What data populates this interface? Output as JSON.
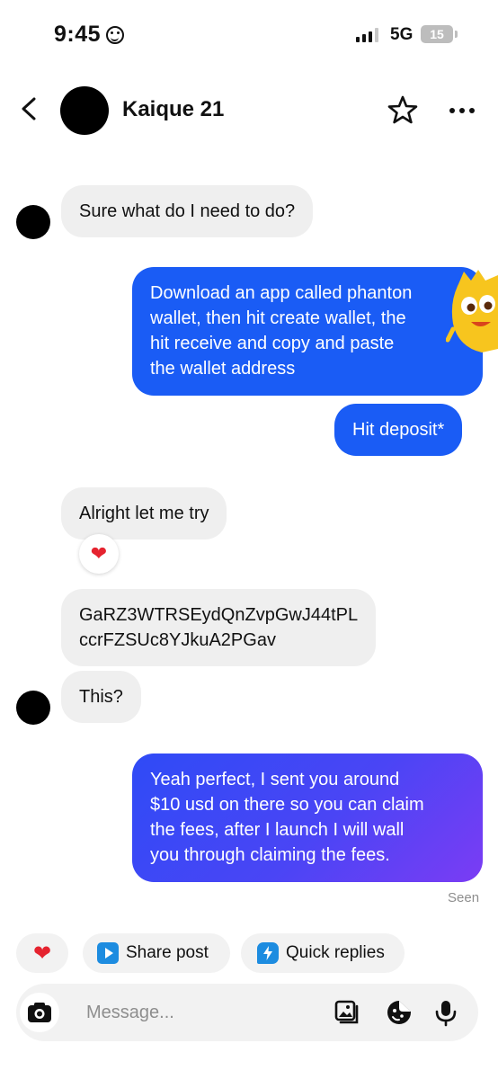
{
  "status_bar": {
    "time": "9:45",
    "network": "5G",
    "battery": "15"
  },
  "header": {
    "contact_name": "Kaique 21"
  },
  "messages": [
    {
      "dir": "in",
      "text": "Sure what do I need to do?"
    },
    {
      "dir": "out",
      "lines": [
        "Download an app called phanton",
        "wallet, then hit create wallet, the",
        "hit receive and copy and paste",
        "the wallet address"
      ]
    },
    {
      "dir": "out",
      "text": "Hit deposit*"
    },
    {
      "dir": "in",
      "text": "Alright let me try",
      "reaction": "❤"
    },
    {
      "dir": "in",
      "lines": [
        "GaRZ3WTRSEydQnZvpGwJ44tPL",
        "ccrFZSUc8YJkuA2PGav"
      ]
    },
    {
      "dir": "in",
      "text": "This?"
    },
    {
      "dir": "out",
      "lines": [
        "Yeah perfect, I sent you around",
        "$10 usd on there so you can claim",
        "the fees, after I launch I will wall",
        "you through claiming the fees."
      ]
    }
  ],
  "seen_label": "Seen",
  "quick_actions": {
    "heart": "❤",
    "share_post": "Share post",
    "quick_replies": "Quick replies"
  },
  "composer": {
    "placeholder": "Message..."
  },
  "colors": {
    "outgoing_top": "#1a5cf5",
    "outgoing_bottom_start": "#2f4bf6",
    "outgoing_bottom_end": "#7b3cf4",
    "incoming": "#efefef",
    "heart": "#e5232f"
  }
}
